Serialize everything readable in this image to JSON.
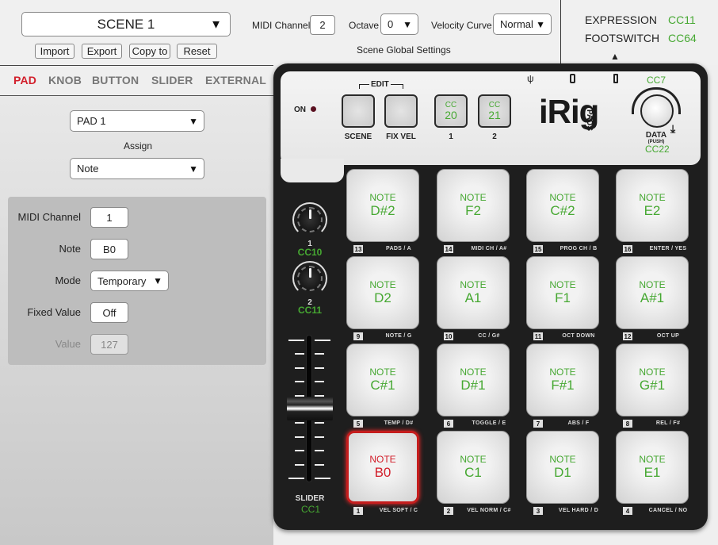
{
  "header": {
    "scene_select": {
      "value": "SCENE 1"
    },
    "buttons": {
      "import": "Import",
      "export": "Export",
      "copy_to": "Copy to",
      "reset": "Reset"
    },
    "midi_channel": {
      "label": "MIDI Channel",
      "value": "2"
    },
    "octave": {
      "label": "Octave",
      "value": "0"
    },
    "velocity_curve": {
      "label": "Velocity Curve",
      "value": "Normal"
    },
    "global_settings_label": "Scene Global Settings",
    "external": [
      {
        "label": "EXPRESSION",
        "cc": "CC11"
      },
      {
        "label": "FOOTSWITCH",
        "cc": "CC64"
      }
    ],
    "external_arrow": "▲"
  },
  "tabs": [
    {
      "label": "PAD",
      "active": true
    },
    {
      "label": "KNOB",
      "active": false
    },
    {
      "label": "BUTTON",
      "active": false
    },
    {
      "label": "SLIDER",
      "active": false
    },
    {
      "label": "EXTERNAL",
      "active": false
    }
  ],
  "left_panel": {
    "pad_select": "PAD 1",
    "assign_label": "Assign",
    "assign_select": "Note",
    "params": {
      "midi_channel": {
        "label": "MIDI Channel",
        "value": "1"
      },
      "note": {
        "label": "Note",
        "value": "B0"
      },
      "mode": {
        "label": "Mode",
        "value": "Temporary"
      },
      "fixed_value": {
        "label": "Fixed Value",
        "value": "Off"
      },
      "value": {
        "label": "Value",
        "value": "127",
        "disabled": true
      }
    }
  },
  "device": {
    "on_label": "ON",
    "edit_label": "EDIT",
    "buttons": [
      {
        "label": "SCENE"
      },
      {
        "label": "FIX VEL"
      },
      {
        "label": "1",
        "cc_label": "CC",
        "cc": "20"
      },
      {
        "label": "2",
        "cc_label": "CC",
        "cc": "21"
      }
    ],
    "logo": "iRig",
    "logo_sub": "PADS",
    "data_knob": {
      "top_cc": "CC7",
      "label": "DATA",
      "sub": "(PUSH)",
      "push_cc": "CC22"
    },
    "knobs": [
      {
        "num": "1",
        "cc": "CC10"
      },
      {
        "num": "2",
        "cc": "CC11"
      }
    ],
    "slider": {
      "label": "SLIDER",
      "cc": "CC1",
      "position": 0.5
    },
    "pads": [
      {
        "num": "13",
        "note_label": "NOTE",
        "note": "D#2",
        "fn": "PADS / A"
      },
      {
        "num": "14",
        "note_label": "NOTE",
        "note": "F2",
        "fn": "MIDI CH / A#"
      },
      {
        "num": "15",
        "note_label": "NOTE",
        "note": "C#2",
        "fn": "PROG CH / B"
      },
      {
        "num": "16",
        "note_label": "NOTE",
        "note": "E2",
        "fn": "ENTER / YES"
      },
      {
        "num": "9",
        "note_label": "NOTE",
        "note": "D2",
        "fn": "NOTE / G"
      },
      {
        "num": "10",
        "note_label": "NOTE",
        "note": "A1",
        "fn": "CC / G#"
      },
      {
        "num": "11",
        "note_label": "NOTE",
        "note": "F1",
        "fn": "OCT DOWN"
      },
      {
        "num": "12",
        "note_label": "NOTE",
        "note": "A#1",
        "fn": "OCT UP"
      },
      {
        "num": "5",
        "note_label": "NOTE",
        "note": "C#1",
        "fn": "TEMP / D#"
      },
      {
        "num": "6",
        "note_label": "NOTE",
        "note": "D#1",
        "fn": "TOGGLE / E"
      },
      {
        "num": "7",
        "note_label": "NOTE",
        "note": "F#1",
        "fn": "ABS / F"
      },
      {
        "num": "8",
        "note_label": "NOTE",
        "note": "G#1",
        "fn": "REL / F#"
      },
      {
        "num": "1",
        "note_label": "NOTE",
        "note": "B0",
        "fn": "VEL SOFT / C",
        "selected": true
      },
      {
        "num": "2",
        "note_label": "NOTE",
        "note": "C1",
        "fn": "VEL NORM / C#"
      },
      {
        "num": "3",
        "note_label": "NOTE",
        "note": "D1",
        "fn": "VEL HARD / D"
      },
      {
        "num": "4",
        "note_label": "NOTE",
        "note": "E1",
        "fn": "CANCEL / NO"
      }
    ]
  },
  "colors": {
    "accent_red": "#d21f2b",
    "cc_green": "#46a832",
    "device_body": "#1e1e1e"
  }
}
